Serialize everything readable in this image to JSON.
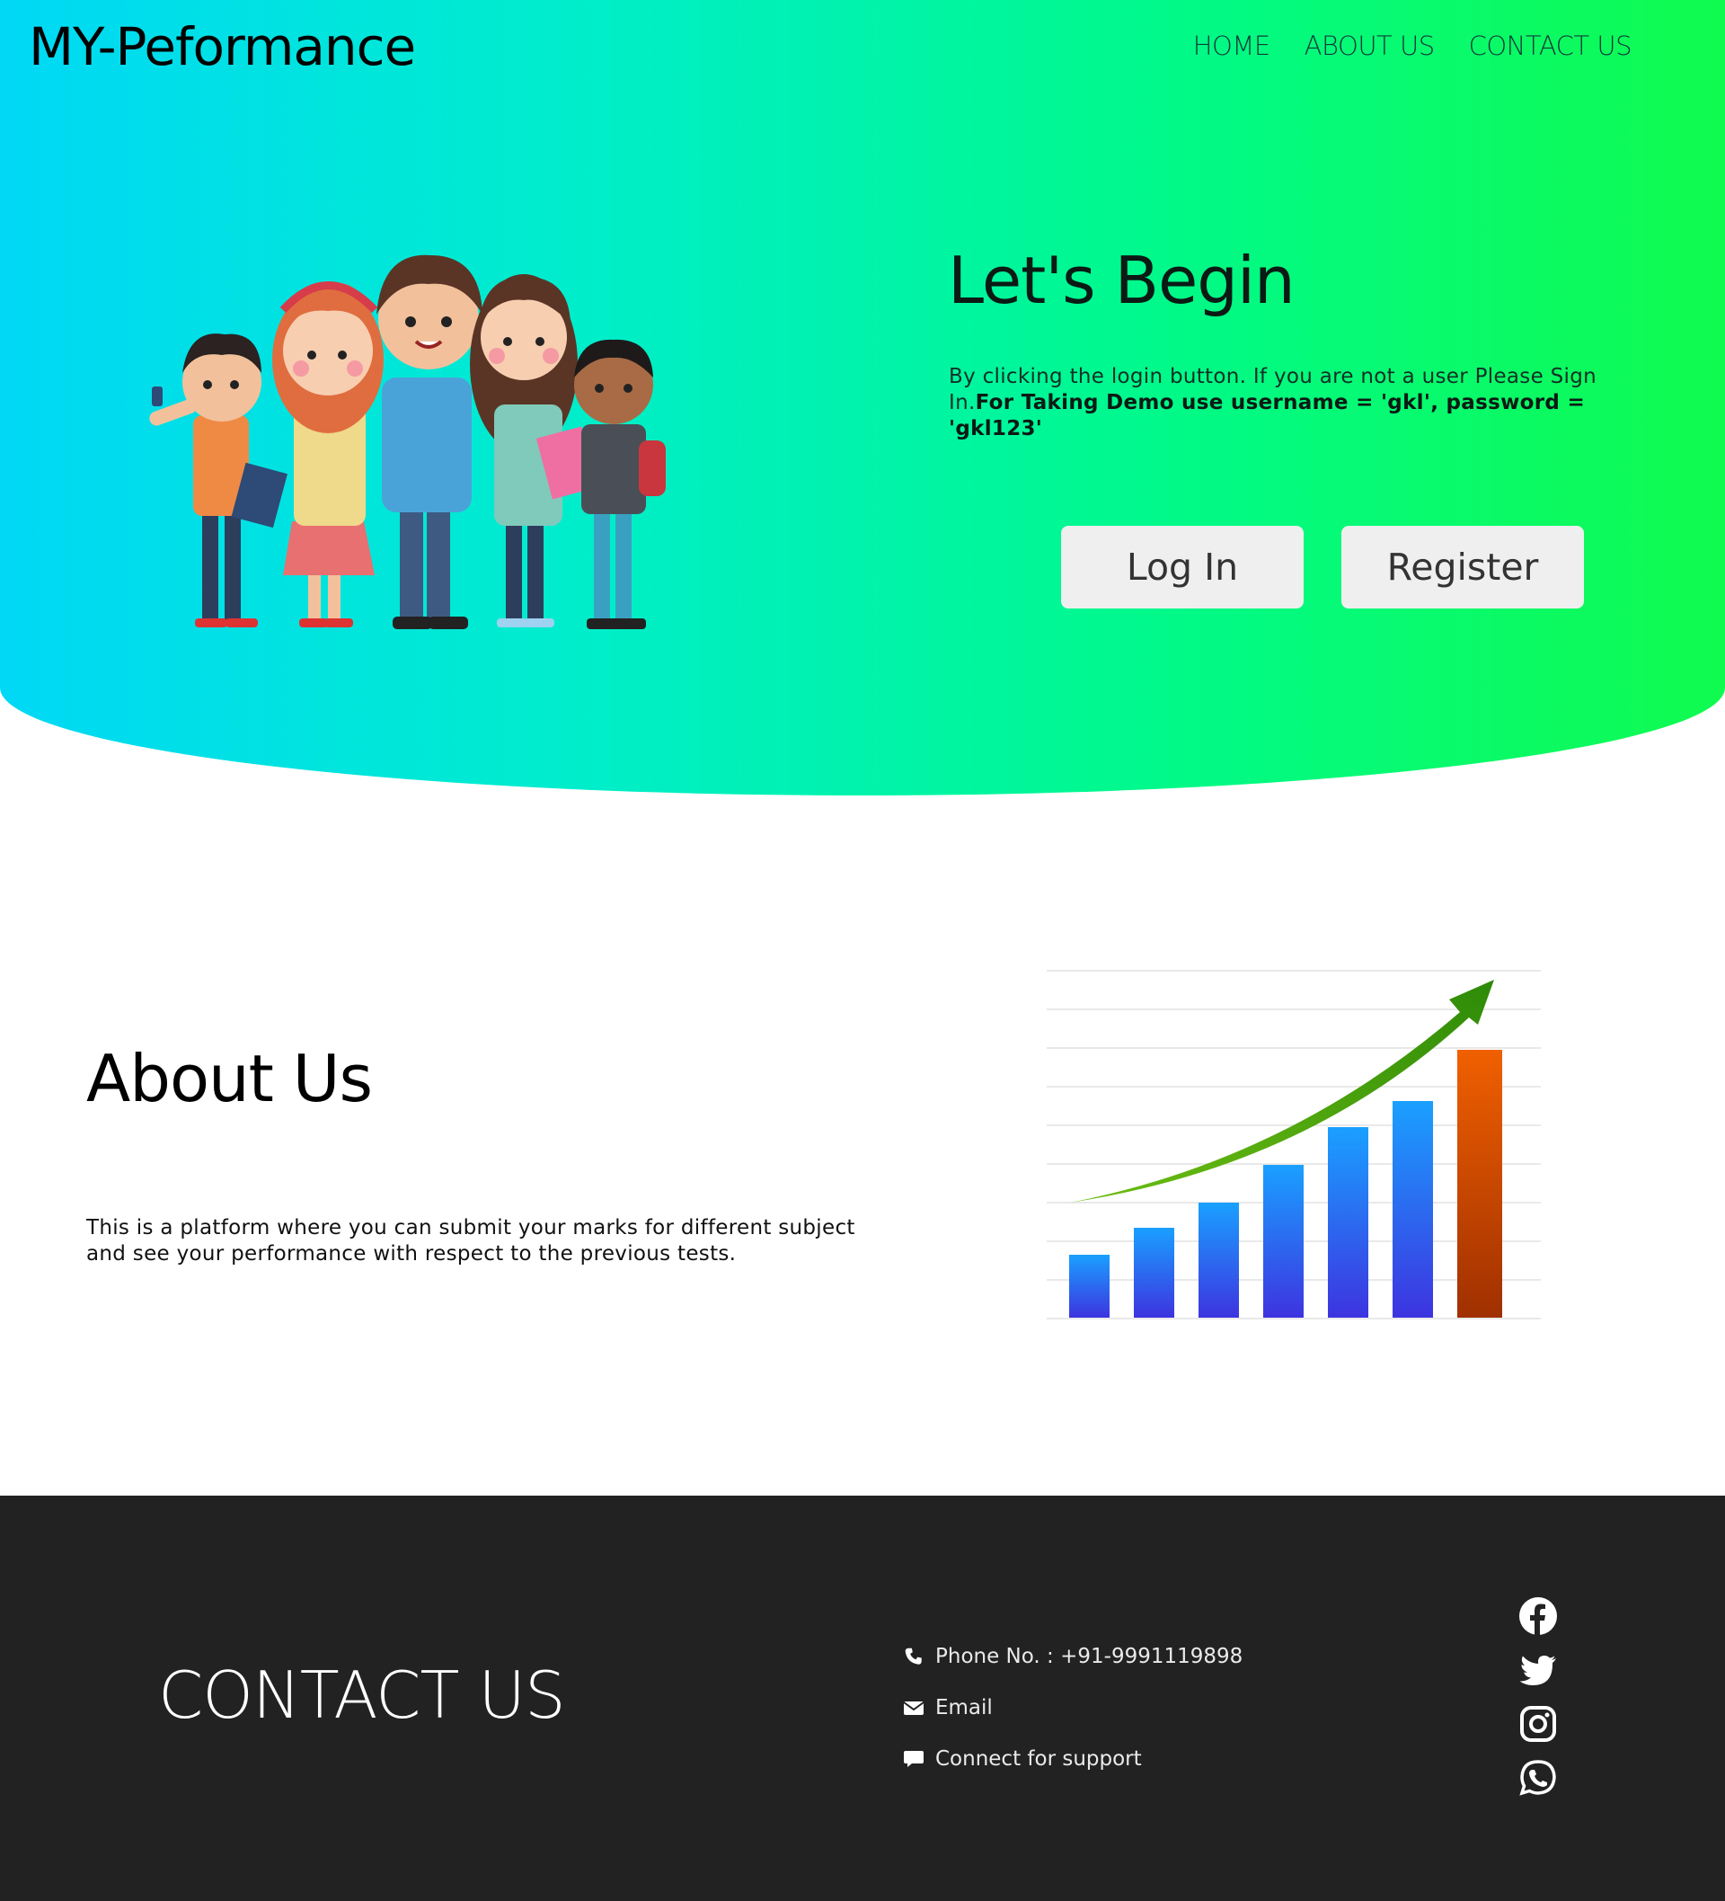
{
  "header": {
    "brand": "MY-Peformance",
    "nav": [
      "HOME",
      "ABOUT US",
      "CONTACT US"
    ]
  },
  "hero": {
    "title": "Let's Begin",
    "text_intro": "By clicking the login button. If you are not a user Please Sign In.",
    "text_demo": "For Taking Demo use username = 'gkl', password = 'gkl123'",
    "login_label": "Log In",
    "register_label": "Register"
  },
  "about": {
    "title": "About Us",
    "text": "This is a platform where you can submit your marks for different subject and see your performance with respect to the previous tests."
  },
  "contact": {
    "title": "CONTACT US",
    "phone": "Phone No. : +91-9991119898",
    "email": "Email",
    "support": "Connect for support",
    "social_icons": [
      "facebook-icon",
      "twitter-icon",
      "instagram-icon",
      "whatsapp-icon"
    ]
  },
  "colors": {
    "hero_gradient_start": "#00d8f6",
    "hero_gradient_end": "#10fb4f",
    "footer_bg": "#222222",
    "button_bg": "#efefef"
  }
}
